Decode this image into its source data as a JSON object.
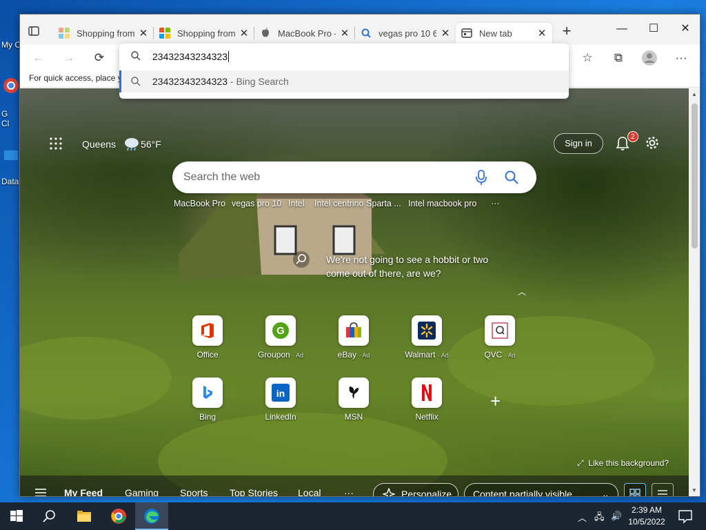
{
  "desktop": {
    "icons": [
      {
        "label": "My C"
      },
      {
        "label": "G"
      },
      {
        "label": "Cl"
      },
      {
        "label": "Data"
      }
    ]
  },
  "browser": {
    "tabs": [
      {
        "title": "Shopping from",
        "icon": "microsoft-shopping-icon",
        "active": false
      },
      {
        "title": "Shopping from",
        "icon": "microsoft-shopping-icon",
        "active": false
      },
      {
        "title": "MacBook Pro -",
        "icon": "apple-icon",
        "active": false
      },
      {
        "title": "vegas pro 10 6",
        "icon": "search-icon",
        "active": false
      },
      {
        "title": "New tab",
        "icon": "new-tab-icon",
        "active": true
      }
    ],
    "address": {
      "value": "23432343234323",
      "suggestion_query": "23432343234323",
      "suggestion_source": "- Bing Search"
    },
    "favorites_bar_text": "For quick access, place y",
    "toolbar_icons": [
      "back-icon",
      "forward-icon",
      "refresh-icon",
      "favorites-icon",
      "collections-icon",
      "profile-icon",
      "more-icon"
    ]
  },
  "newtab": {
    "location": "Queens",
    "temperature": "56°F",
    "signin": "Sign in",
    "notification_count": "2",
    "search_placeholder": "Search the web",
    "trending": [
      "MacBook Pro",
      "vegas pro 10",
      "Intel",
      "Intel centrino Sparta ...",
      "Intel macbook pro",
      "···"
    ],
    "caption_line1": "We're not going to see a hobbit or two",
    "caption_line2": "come out of there, are we?",
    "tiles_row1": [
      {
        "name": "Office",
        "ad": ""
      },
      {
        "name": "Groupon",
        "ad": "· Ad"
      },
      {
        "name": "eBay",
        "ad": "· Ad"
      },
      {
        "name": "Walmart",
        "ad": "· Ad"
      },
      {
        "name": "QVC",
        "ad": "· Ad"
      }
    ],
    "tiles_row2": [
      {
        "name": "Bing",
        "ad": ""
      },
      {
        "name": "LinkedIn",
        "ad": ""
      },
      {
        "name": "MSN",
        "ad": ""
      },
      {
        "name": "Netflix",
        "ad": ""
      }
    ],
    "like_background": "Like this background?",
    "feed": {
      "items": [
        "My Feed",
        "Gaming",
        "Sports",
        "Top Stories",
        "Local",
        "···"
      ],
      "personalize": "Personalize",
      "content_visibility": "Content partially visible"
    }
  },
  "taskbar": {
    "time": "2:39 AM",
    "date": "10/5/2022"
  },
  "colors": {
    "accent": "#2f6fd6",
    "badge": "#d83b2d",
    "taskbar": "#1c2633"
  }
}
